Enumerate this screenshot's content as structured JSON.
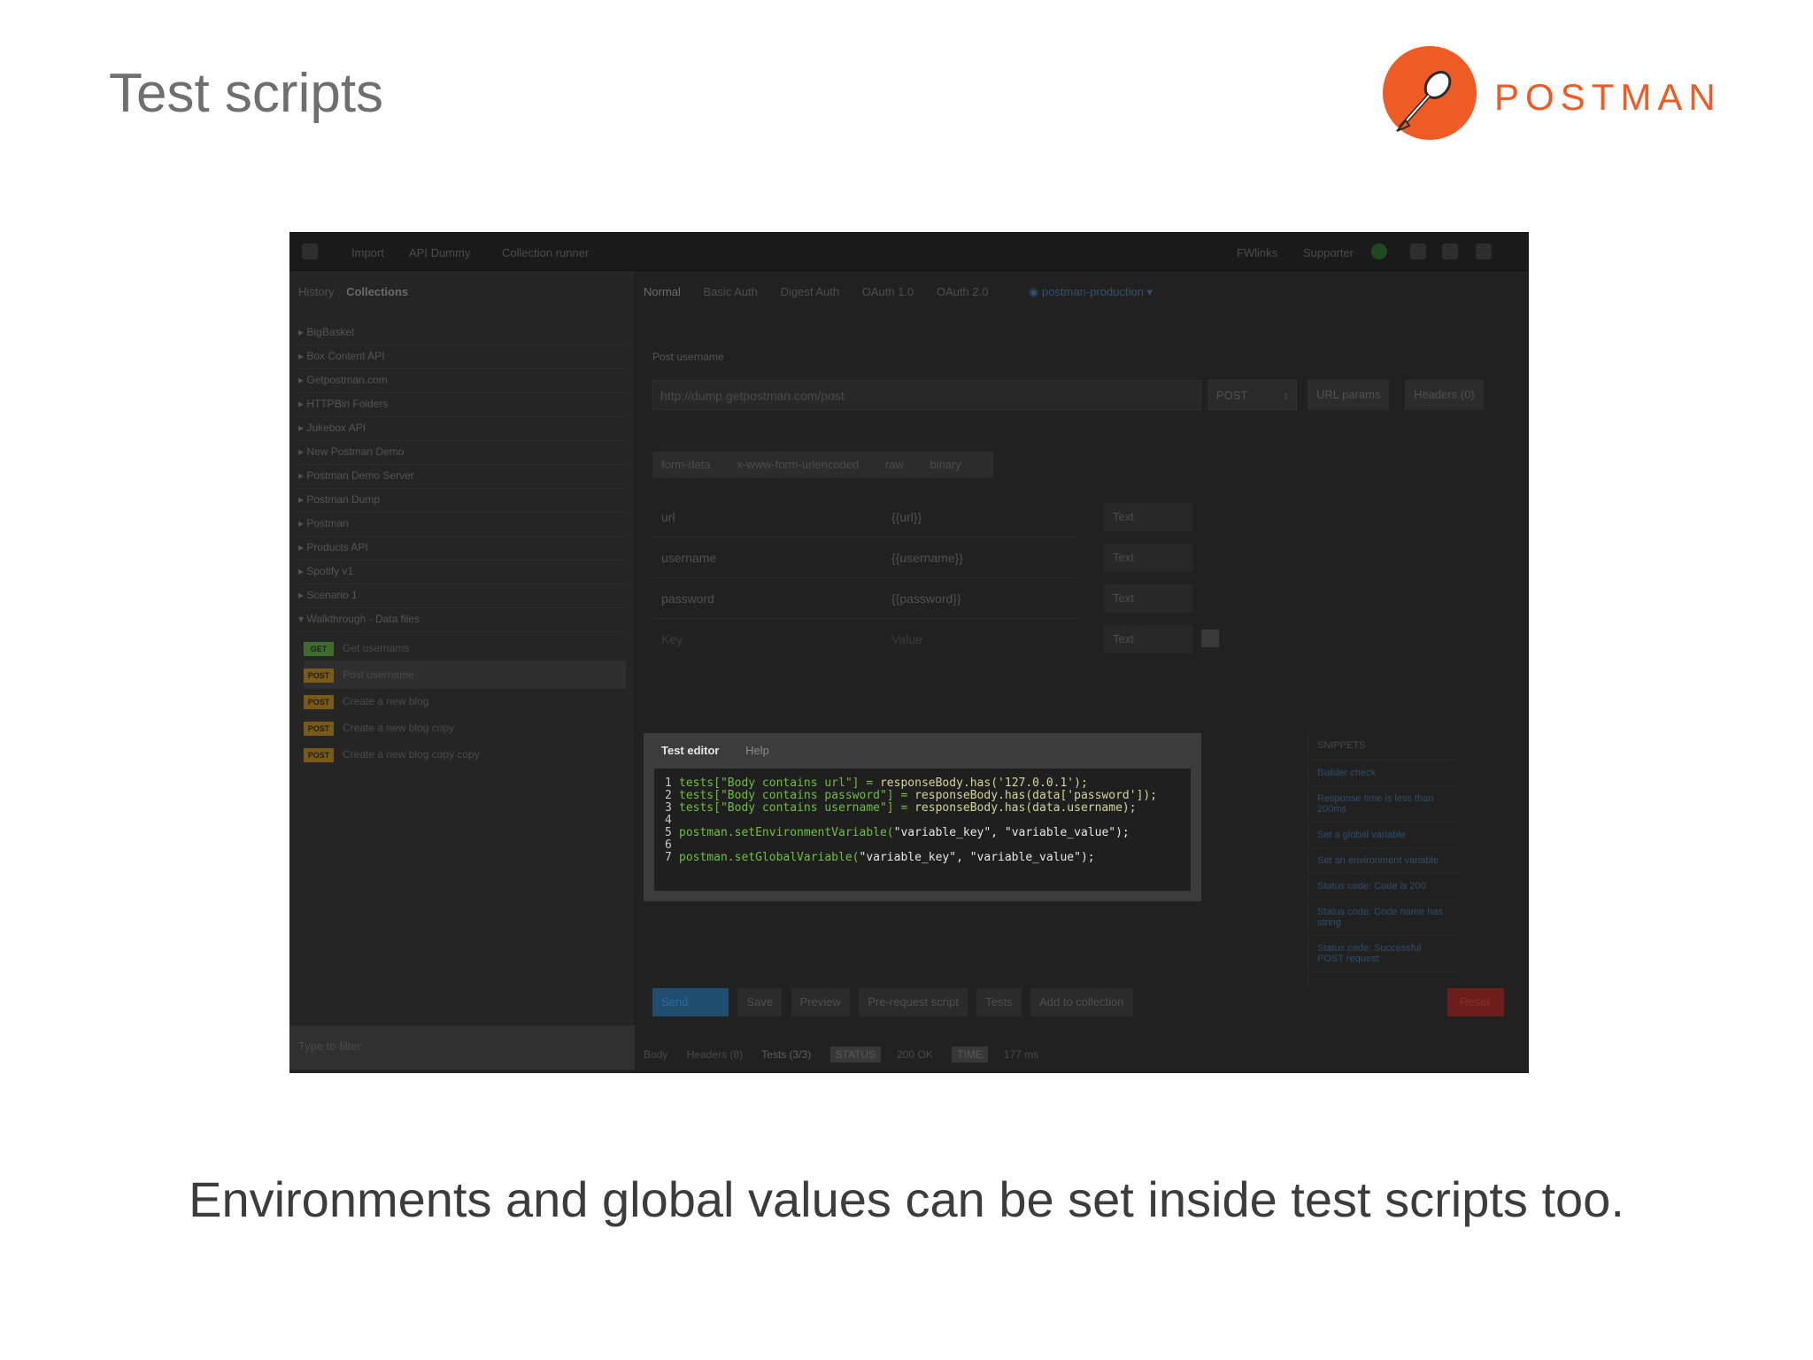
{
  "slide": {
    "title": "Test scripts",
    "logo_text": "POSTMAN",
    "caption": "Environments and global values can be set inside test scripts too."
  },
  "colors": {
    "brand": "#ef5b25",
    "code_green": "#6fbf3c",
    "code_yellow": "#d4d69a"
  },
  "app": {
    "topbar": [
      "Import",
      "API Dummy",
      "Collection runner",
      "FWlinks",
      "Supporter"
    ],
    "sidebar": {
      "tabs": [
        "History",
        "Collections"
      ],
      "collections": [
        "BigBasket",
        "Box Content API",
        "Getpostman.com",
        "HTTPBin Folders",
        "Jukebox API",
        "New Postman Demo",
        "Postman Demo Server",
        "Postman Dump",
        "Postman",
        "Products API",
        "Spotify v1",
        "Scenario 1",
        "Walkthrough - Data files"
      ],
      "requests": [
        {
          "method": "GET",
          "name": "Get usernams"
        },
        {
          "method": "POST",
          "name": "Post username"
        },
        {
          "method": "POST",
          "name": "Create a new blog"
        },
        {
          "method": "POST",
          "name": "Create a new blog copy"
        },
        {
          "method": "POST",
          "name": "Create a new blog copy copy"
        }
      ],
      "filter_placeholder": "Type to filter"
    },
    "auth_tabs": [
      "Normal",
      "Basic Auth",
      "Digest Auth",
      "OAuth 1.0",
      "OAuth 2.0"
    ],
    "environment": "postman-production",
    "request_name": "Post username",
    "url": "http://dump.getpostman.com/post",
    "method": "POST",
    "url_params_label": "URL params",
    "headers_label": "Headers (0)",
    "body_tabs": [
      "form-data",
      "x-www-form-urlencoded",
      "raw",
      "binary"
    ],
    "form_rows": [
      {
        "key": "url",
        "value": "{{url}}",
        "type": "Text"
      },
      {
        "key": "username",
        "value": "{{username}}",
        "type": "Text"
      },
      {
        "key": "password",
        "value": "{{password}}",
        "type": "Text"
      },
      {
        "key": "Key",
        "value": "Value",
        "type": "Text"
      }
    ],
    "editor": {
      "tabs": [
        "Test editor",
        "Help"
      ],
      "lines": [
        {
          "n": "1",
          "a": "tests[\"Body contains url\"] = ",
          "b": "responseBody.has('127.0.0.1');"
        },
        {
          "n": "2",
          "a": "tests[\"Body contains password\"] = ",
          "b": "responseBody.has(data['password']);"
        },
        {
          "n": "3",
          "a": "tests[\"Body contains username\"] = ",
          "b": "responseBody.has(data.username);"
        },
        {
          "n": "4",
          "a": "",
          "b": ""
        },
        {
          "n": "5",
          "a": "postman.setEnvironmentVariable(",
          "b": "\"variable_key\", \"variable_value\");"
        },
        {
          "n": "6",
          "a": "",
          "b": ""
        },
        {
          "n": "7",
          "a": "postman.setGlobalVariable(",
          "b": "\"variable_key\", \"variable_value\");"
        }
      ]
    },
    "snippets": {
      "header": "SNIPPETS",
      "items": [
        "Builder check",
        "Response time is less than 200ms",
        "Set a global variable",
        "Set an environment variable",
        "Status code: Code is 200",
        "Status code: Code name has string",
        "Status code: Successful POST request"
      ]
    },
    "actions": [
      "Send",
      "Save",
      "Preview",
      "Pre-request script",
      "Tests",
      "Add to collection"
    ],
    "reset_label": "Reset",
    "response": {
      "tabs": [
        "Body",
        "Headers (8)",
        "Tests (3/3)"
      ],
      "status_label": "STATUS",
      "status_value": "200 OK",
      "time_label": "TIME",
      "time_value": "177 ms"
    }
  }
}
